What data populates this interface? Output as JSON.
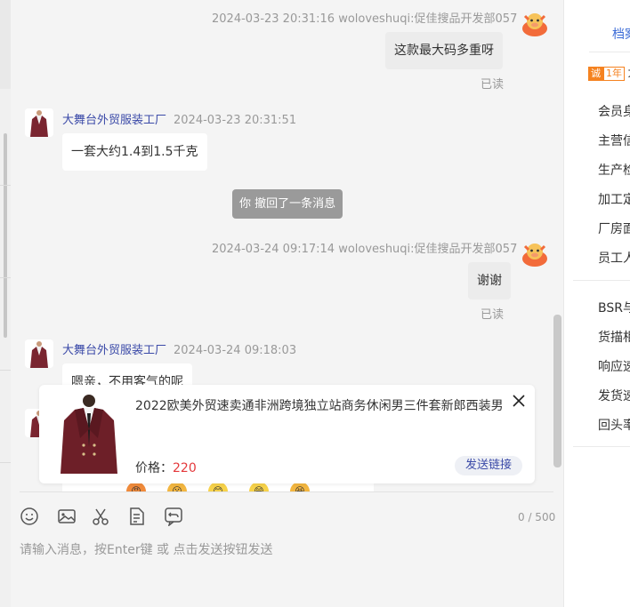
{
  "messages": {
    "m1": {
      "meta": "2024-03-23 20:31:16  woloveshuqi:促佳搜品开发部057",
      "text": "这款最大码多重呀",
      "status": "已读"
    },
    "m2": {
      "name": "大舞台外贸服装工厂",
      "time": "2024-03-23 20:31:51",
      "text": "一套大约1.4到1.5千克"
    },
    "recall": "你 撤回了一条消息",
    "m3": {
      "meta": "2024-03-24 09:17:14  woloveshuqi:促佳搜品开发部057",
      "text": "谢谢",
      "status": "已读"
    },
    "m4": {
      "name": "大舞台外贸服装工厂",
      "time": "2024-03-24 09:18:03",
      "text": "嗯亲，不用客气的呢"
    }
  },
  "product_card": {
    "title": "2022欧美外贸速卖通非洲跨境独立站商务休闲男三件套新郎西装男",
    "price_label": "价格：",
    "price_value": "220",
    "send_label": "发送链接"
  },
  "input": {
    "placeholder": "请输入消息，按Enter键 或 点击发送按钮发送",
    "counter": "0 / 500"
  },
  "panel": {
    "tab": "档案",
    "badge_cheng": "诚",
    "badge_years": "1年",
    "badge_more": "大",
    "items": [
      "会员身",
      "主营信",
      "生产检",
      "加工定",
      "厂房面",
      "员工人",
      "BSR与",
      "货描相",
      "响应速",
      "发货速",
      "回头率"
    ]
  },
  "colors": {
    "accent": "#3b6bd6",
    "name_blue": "#3b4aa8",
    "price_red": "#e4393c",
    "badge_orange": "#f58220"
  }
}
